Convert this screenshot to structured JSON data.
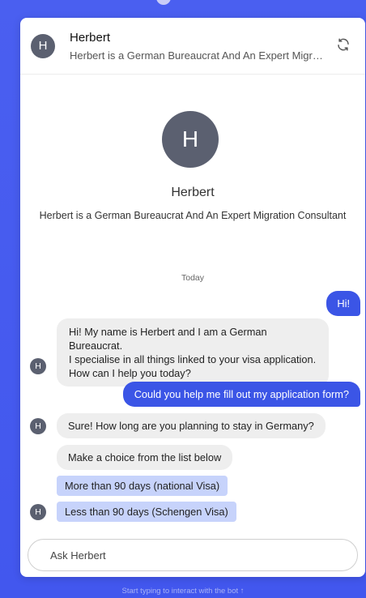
{
  "header": {
    "avatar_initial": "H",
    "name": "Herbert",
    "description": "Herbert is a German Bureaucrat And An Expert Migration Consultant",
    "refresh_icon": "refresh-icon"
  },
  "profile": {
    "avatar_initial": "H",
    "name": "Herbert",
    "description": "Herbert is a German Bureaucrat And An Expert Migration Consultant"
  },
  "chat": {
    "date_separator": "Today",
    "messages": [
      {
        "from": "user",
        "text": "Hi!"
      },
      {
        "from": "bot",
        "lines": [
          "Hi! My name is Herbert and I am a German Bureaucrat.",
          "I specialise in all things linked to your visa application.",
          "How can I help you today?"
        ],
        "avatar_initial": "H"
      },
      {
        "from": "user",
        "text": "Could you help me fill out my application form?"
      },
      {
        "from": "bot",
        "text": "Sure! How long are you planning to stay in Germany?",
        "avatar_initial": "H"
      },
      {
        "from": "bot",
        "text": "Make a choice from the list below"
      }
    ],
    "choices": [
      "More than 90 days (national Visa)",
      "Less than 90 days (Schengen Visa)"
    ],
    "choices_avatar_initial": "H"
  },
  "composer": {
    "placeholder": "Ask Herbert"
  },
  "footer": {
    "hint": "Start typing to interact with the bot ↑"
  },
  "colors": {
    "background": "#4257ee",
    "user_bubble": "#3b55e6",
    "bot_bubble": "#eeeeee",
    "choice_chip": "#c7d3fb",
    "avatar": "#5b6070"
  }
}
